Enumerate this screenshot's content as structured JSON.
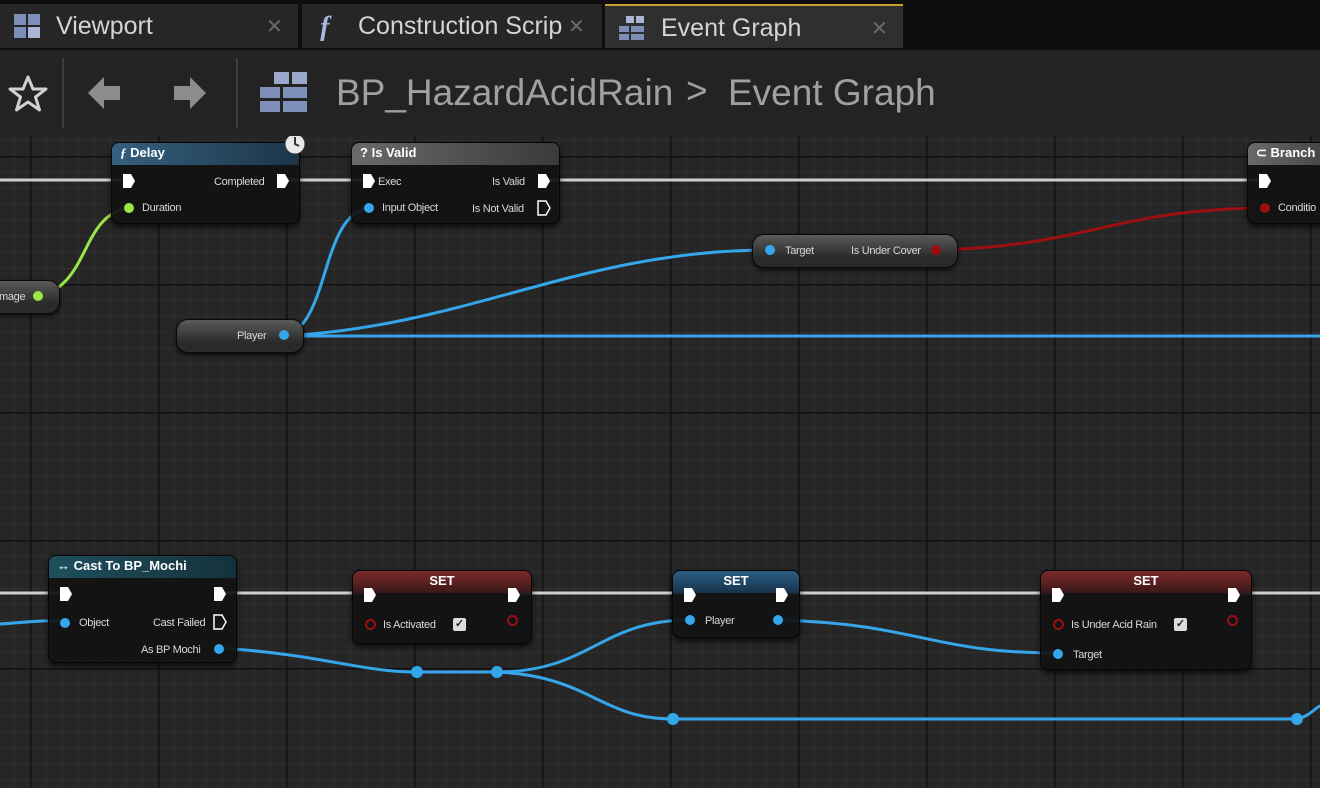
{
  "tabs": [
    {
      "label": "Viewport",
      "icon": "viewport-icon",
      "active": false
    },
    {
      "label": "Construction Scrip",
      "icon": "function-icon",
      "active": false
    },
    {
      "label": "Event Graph",
      "icon": "event-graph-icon",
      "active": true
    }
  ],
  "breadcrumb": {
    "blueprint": "BP_HazardAcidRain",
    "separator": ">",
    "graph": "Event Graph"
  },
  "colors": {
    "exec": "#ffffff",
    "object_pin": "#35a6ea",
    "bool_pin": "#9c0f0f",
    "float_pin": "#9ae547",
    "function_header": "#35607f",
    "pure_header": "#5f5f5f",
    "set_bool_header": "#5e1b1b",
    "set_object_header": "#1f4a6c",
    "cast_header": "#1f4f5d"
  },
  "nodes": {
    "delay": {
      "title": "Delay",
      "completed": "Completed",
      "duration": "Duration"
    },
    "is_valid": {
      "title": "Is Valid",
      "exec": "Exec",
      "is_valid": "Is Valid",
      "input_object": "Input Object",
      "is_not_valid": "Is Not Valid"
    },
    "is_under_cover": {
      "target": "Target",
      "output": "Is Under Cover"
    },
    "branch": {
      "title": "Branch",
      "condition": "Conditio"
    },
    "damage_var": {
      "label": "mage"
    },
    "player_var": {
      "label": "Player"
    },
    "cast": {
      "title": "Cast To BP_Mochi",
      "object": "Object",
      "cast_failed": "Cast Failed",
      "as_bp_mochi": "As BP Mochi"
    },
    "set_activated": {
      "title": "SET",
      "var": "Is Activated",
      "checked": true
    },
    "set_player": {
      "title": "SET",
      "var": "Player"
    },
    "set_under_acid_rain": {
      "title": "SET",
      "var": "Is Under Acid Rain",
      "target": "Target",
      "checked": true
    }
  }
}
